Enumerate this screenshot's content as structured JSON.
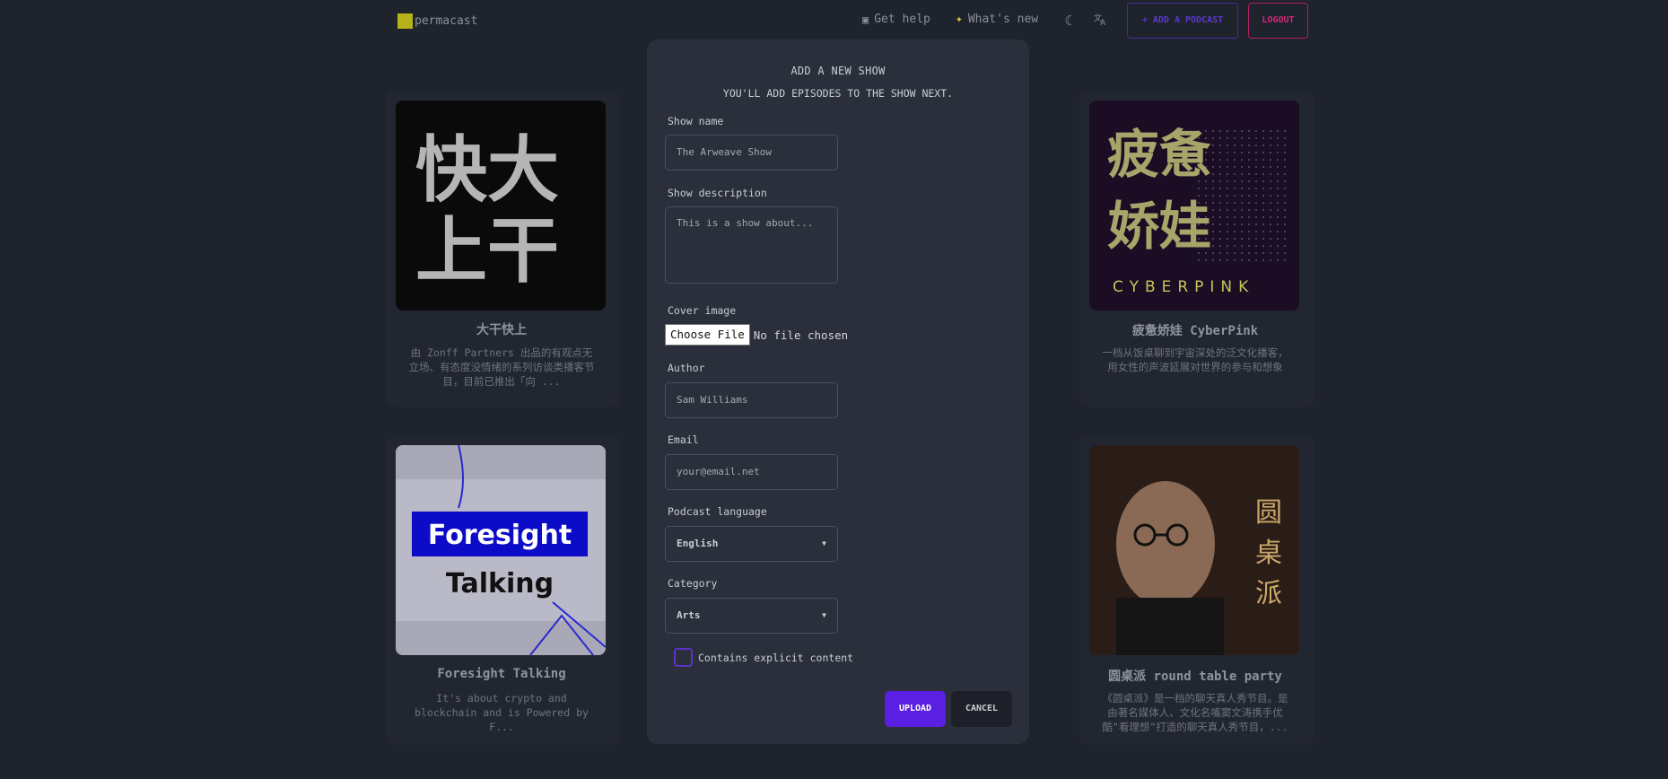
{
  "nav": {
    "brand": "permacast",
    "get_help": "Get help",
    "whats_new": "What's new",
    "add_podcast": "+ ADD A PODCAST",
    "logout": "LOGOUT",
    "brand_color": "#b8b21a",
    "accent_purple": "#5a1fe0",
    "accent_pink": "#d02a7a"
  },
  "cards": [
    {
      "title": "大干快上",
      "description": "由 Zonff Partners 出品的有观点无立场、有态度没情绪的系列访谈类播客节目，目前已推出「向 ...",
      "cover_text": [
        "快大",
        "上干"
      ]
    },
    {
      "title": "疲惫娇娃 CyberPink",
      "description": "一档从饭桌聊到宇宙深处的泛文化播客，用女性的声波延展对世界的参与和想象",
      "cover_text": [
        "疲惫",
        "娇娃",
        "CYBERPINK"
      ]
    },
    {
      "title": "Foresight Talking",
      "description": "It's about crypto and blockchain and is Powered by F...",
      "cover_text": [
        "Foresight",
        "Talking"
      ]
    },
    {
      "title": "圆桌派 round table party",
      "description": "《圆桌派》是一档的聊天真人秀节目。是由著名媒体人、文化名嘴窦文涛携手优酷\"看理想\"打造的聊天真人秀节目，...",
      "cover_text": [
        "圆",
        "桌",
        "派"
      ]
    }
  ],
  "modal": {
    "title": "ADD A NEW SHOW",
    "subtitle": "YOU'LL ADD EPISODES TO THE SHOW NEXT.",
    "show_name": {
      "label": "Show name",
      "placeholder": "The Arweave Show"
    },
    "show_description": {
      "label": "Show description",
      "placeholder": "This is a show about..."
    },
    "cover_image": {
      "label": "Cover image",
      "button": "Choose File",
      "status": "No file chosen"
    },
    "author": {
      "label": "Author",
      "placeholder": "Sam Williams"
    },
    "email": {
      "label": "Email",
      "placeholder": "your@email.net"
    },
    "language": {
      "label": "Podcast language",
      "value": "English"
    },
    "category": {
      "label": "Category",
      "value": "Arts"
    },
    "explicit": {
      "label": "Contains explicit content",
      "checked": false
    },
    "upload": "UPLOAD",
    "cancel": "CANCEL"
  }
}
